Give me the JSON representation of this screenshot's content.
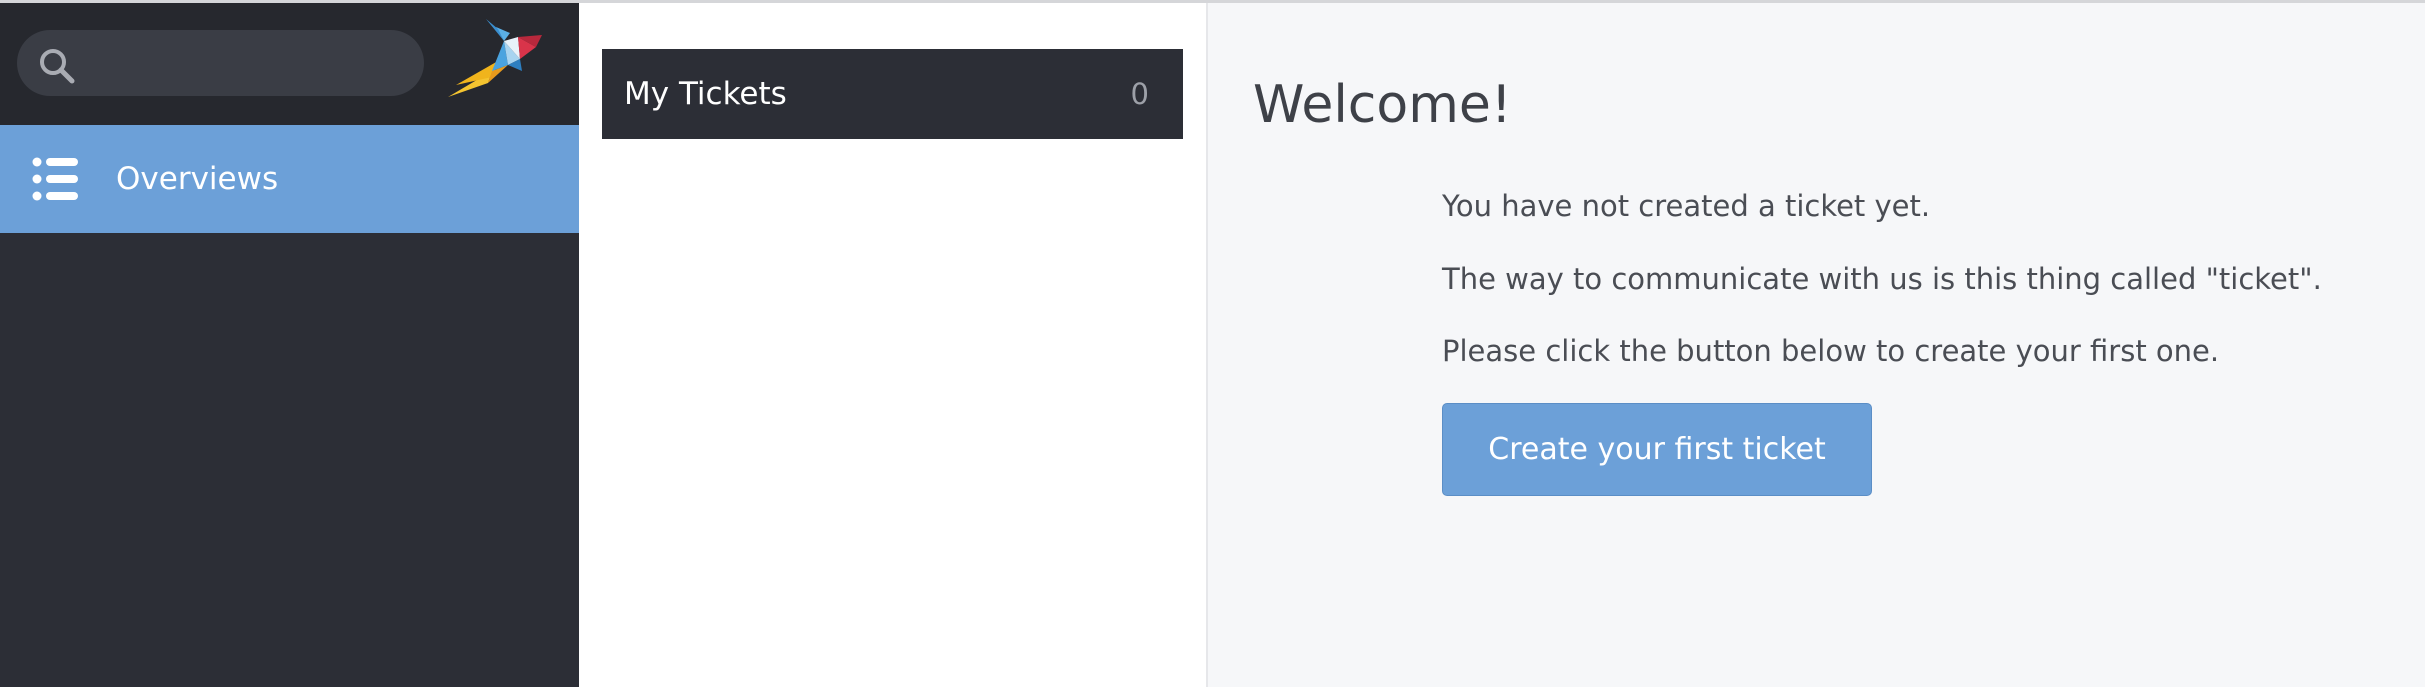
{
  "sidebar": {
    "search": {
      "placeholder": "",
      "value": ""
    },
    "nav": {
      "overviews_label": "Overviews"
    }
  },
  "overviews_list": {
    "items": [
      {
        "label": "My Tickets",
        "count": "0"
      }
    ]
  },
  "main": {
    "title": "Welcome!",
    "messages": [
      "You have not created a ticket yet.",
      "The way to communicate with us is this thing called \"ticket\".",
      "Please click the button below to create your first one."
    ],
    "create_button_label": "Create your first ticket"
  },
  "colors": {
    "sidebar_bg": "#2c2e36",
    "accent": "#6ca0d8",
    "main_bg": "#f6f7f9"
  },
  "icons": {
    "search": "search-icon",
    "logo": "logo-icon",
    "overviews": "list-icon"
  }
}
